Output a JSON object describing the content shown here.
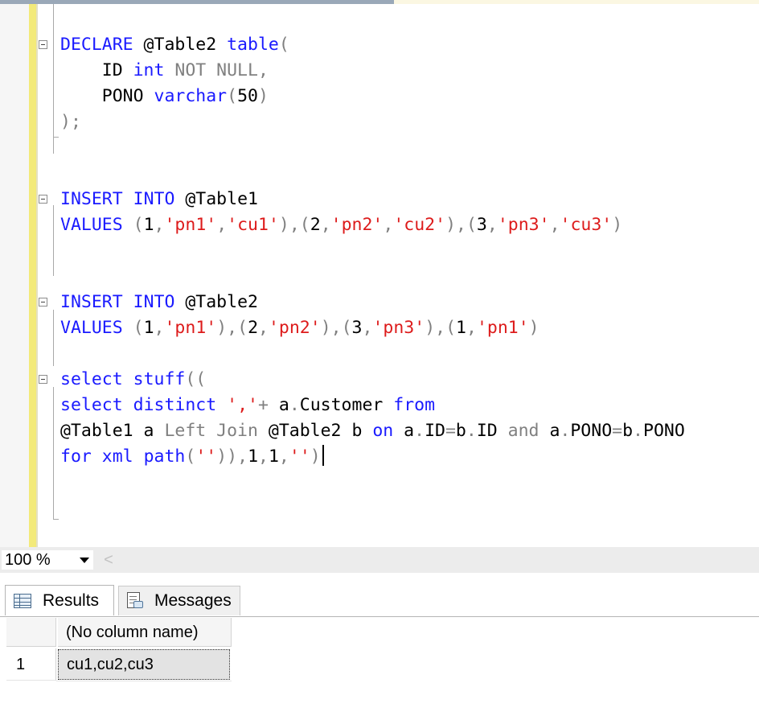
{
  "editor": {
    "lines": [
      [
        {
          "t": "DECLARE",
          "c": "kw"
        },
        {
          "t": " @Table2 "
        },
        {
          "t": "table",
          "c": "kw"
        },
        {
          "t": "(",
          "c": "gry"
        }
      ],
      [
        {
          "t": "    ID "
        },
        {
          "t": "int",
          "c": "kw"
        },
        {
          "t": " NOT NULL",
          "c": "gry"
        },
        {
          "t": ",",
          "c": "gry"
        }
      ],
      [
        {
          "t": "    PONO "
        },
        {
          "t": "varchar",
          "c": "kw"
        },
        {
          "t": "(",
          "c": "gry"
        },
        {
          "t": "50"
        },
        {
          "t": ")",
          "c": "gry"
        }
      ],
      [
        {
          "t": ");",
          "c": "gry"
        }
      ],
      [],
      [],
      [
        {
          "t": "INSERT",
          "c": "kw"
        },
        {
          "t": " "
        },
        {
          "t": "INTO",
          "c": "kw"
        },
        {
          "t": " @Table1"
        }
      ],
      [
        {
          "t": "VALUES",
          "c": "kw"
        },
        {
          "t": " "
        },
        {
          "t": "(",
          "c": "gry"
        },
        {
          "t": "1"
        },
        {
          "t": ",",
          "c": "gry"
        },
        {
          "t": "'pn1'",
          "c": "str"
        },
        {
          "t": ",",
          "c": "gry"
        },
        {
          "t": "'cu1'",
          "c": "str"
        },
        {
          "t": "),(",
          "c": "gry"
        },
        {
          "t": "2"
        },
        {
          "t": ",",
          "c": "gry"
        },
        {
          "t": "'pn2'",
          "c": "str"
        },
        {
          "t": ",",
          "c": "gry"
        },
        {
          "t": "'cu2'",
          "c": "str"
        },
        {
          "t": "),(",
          "c": "gry"
        },
        {
          "t": "3"
        },
        {
          "t": ",",
          "c": "gry"
        },
        {
          "t": "'pn3'",
          "c": "str"
        },
        {
          "t": ",",
          "c": "gry"
        },
        {
          "t": "'cu3'",
          "c": "str"
        },
        {
          "t": ")",
          "c": "gry"
        }
      ],
      [],
      [],
      [
        {
          "t": "INSERT",
          "c": "kw"
        },
        {
          "t": " "
        },
        {
          "t": "INTO",
          "c": "kw"
        },
        {
          "t": " @Table2"
        }
      ],
      [
        {
          "t": "VALUES",
          "c": "kw"
        },
        {
          "t": " "
        },
        {
          "t": "(",
          "c": "gry"
        },
        {
          "t": "1"
        },
        {
          "t": ",",
          "c": "gry"
        },
        {
          "t": "'pn1'",
          "c": "str"
        },
        {
          "t": "),(",
          "c": "gry"
        },
        {
          "t": "2"
        },
        {
          "t": ",",
          "c": "gry"
        },
        {
          "t": "'pn2'",
          "c": "str"
        },
        {
          "t": "),(",
          "c": "gry"
        },
        {
          "t": "3"
        },
        {
          "t": ",",
          "c": "gry"
        },
        {
          "t": "'pn3'",
          "c": "str"
        },
        {
          "t": "),(",
          "c": "gry"
        },
        {
          "t": "1"
        },
        {
          "t": ",",
          "c": "gry"
        },
        {
          "t": "'pn1'",
          "c": "str"
        },
        {
          "t": ")",
          "c": "gry"
        }
      ],
      [],
      [
        {
          "t": "select",
          "c": "kw"
        },
        {
          "t": " "
        },
        {
          "t": "stuff",
          "c": "kw"
        },
        {
          "t": "((",
          "c": "gry"
        }
      ],
      [
        {
          "t": "select",
          "c": "kw"
        },
        {
          "t": " "
        },
        {
          "t": "distinct",
          "c": "kw"
        },
        {
          "t": " "
        },
        {
          "t": "','",
          "c": "str"
        },
        {
          "t": "+",
          "c": "gry"
        },
        {
          "t": " a"
        },
        {
          "t": ".",
          "c": "gry"
        },
        {
          "t": "Customer "
        },
        {
          "t": "from",
          "c": "kw"
        }
      ],
      [
        {
          "t": "@Table1 a "
        },
        {
          "t": "Left Join",
          "c": "gry"
        },
        {
          "t": " @Table2 b "
        },
        {
          "t": "on",
          "c": "kw"
        },
        {
          "t": " a"
        },
        {
          "t": ".",
          "c": "gry"
        },
        {
          "t": "ID"
        },
        {
          "t": "=",
          "c": "gry"
        },
        {
          "t": "b"
        },
        {
          "t": ".",
          "c": "gry"
        },
        {
          "t": "ID "
        },
        {
          "t": "and",
          "c": "gry"
        },
        {
          "t": " a"
        },
        {
          "t": ".",
          "c": "gry"
        },
        {
          "t": "PONO"
        },
        {
          "t": "=",
          "c": "gry"
        },
        {
          "t": "b"
        },
        {
          "t": ".",
          "c": "gry"
        },
        {
          "t": "PONO"
        }
      ],
      [
        {
          "t": "for",
          "c": "kw"
        },
        {
          "t": " "
        },
        {
          "t": "xml",
          "c": "kw"
        },
        {
          "t": " "
        },
        {
          "t": "path",
          "c": "kw"
        },
        {
          "t": "(",
          "c": "gry"
        },
        {
          "t": "''",
          "c": "str"
        },
        {
          "t": ")),",
          "c": "gry"
        },
        {
          "t": "1"
        },
        {
          "t": ",",
          "c": "gry"
        },
        {
          "t": "1"
        },
        {
          "t": ",",
          "c": "gry"
        },
        {
          "t": "''",
          "c": "str"
        },
        {
          "t": ")",
          "c": "gry"
        }
      ]
    ],
    "caret_line": 16,
    "colors": {
      "keyword": "#1a1aff",
      "string": "#dd1b1b",
      "operator": "#808080",
      "change_bar": "#f3ea7a"
    }
  },
  "zoom": {
    "level": "100 %",
    "scroll_left_glyph": "<"
  },
  "tabs": [
    {
      "label": "Results",
      "icon": "results-grid-icon",
      "active": true
    },
    {
      "label": "Messages",
      "icon": "messages-icon",
      "active": false
    }
  ],
  "results": {
    "columns": [
      "(No column name)"
    ],
    "rows": [
      {
        "num": "1",
        "cells": [
          "cu1,cu2,cu3"
        ]
      }
    ]
  }
}
